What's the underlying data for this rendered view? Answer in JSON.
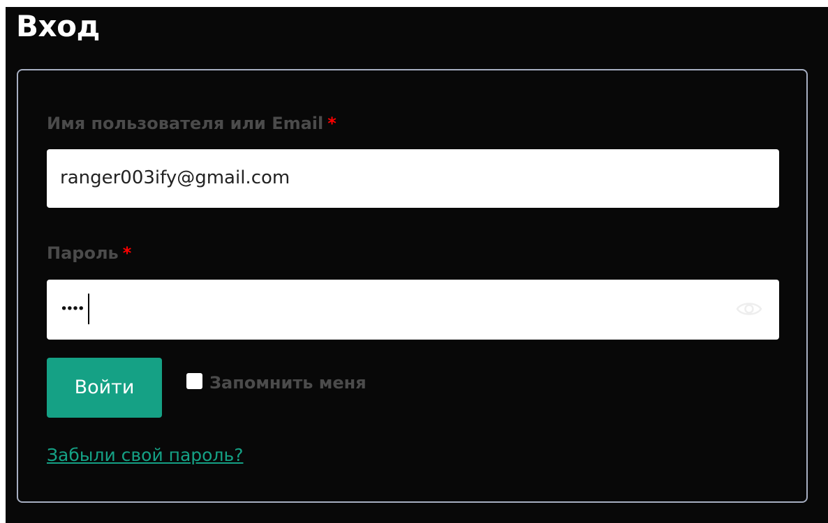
{
  "page": {
    "title": "Вход"
  },
  "login_form": {
    "username": {
      "label": "Имя пользователя или Email",
      "required_mark": "*",
      "value": "ranger003ify@gmail.com"
    },
    "password": {
      "label": "Пароль",
      "required_mark": "*",
      "masked_value": "••••",
      "toggle_icon": "eye-icon"
    },
    "submit_label": "Войти",
    "remember_me": {
      "label": "Запомнить меня",
      "checked": false
    },
    "forgot_password_label": "Забыли свой пароль?"
  },
  "colors": {
    "page_background": "#080808",
    "card_border": "#a7afc2",
    "label_text": "#4b4b4b",
    "required_mark": "#ff0000",
    "accent": "#15a185",
    "input_background": "#ffffff"
  }
}
